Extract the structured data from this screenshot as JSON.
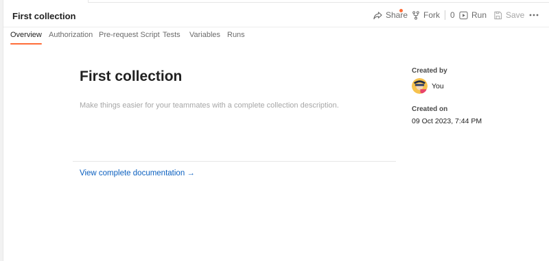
{
  "header": {
    "title": "First collection",
    "share_label": "Share",
    "fork_label": "Fork",
    "fork_count": "0",
    "run_label": "Run",
    "save_label": "Save"
  },
  "tabs": [
    {
      "label": "Overview",
      "active": true
    },
    {
      "label": "Authorization"
    },
    {
      "label": "Pre-request Script"
    },
    {
      "label": "Tests"
    },
    {
      "label": "Variables"
    },
    {
      "label": "Runs"
    }
  ],
  "overview": {
    "title": "First collection",
    "description_placeholder": "Make things easier for your teammates with a complete collection description.",
    "docs_link": "View complete documentation →"
  },
  "side": {
    "created_by_label": "Created by",
    "created_by_value": "You",
    "created_on_label": "Created on",
    "created_on_value": "09 Oct 2023, 7:44 PM"
  },
  "colors": {
    "accent": "#ff6c37",
    "link": "#0a5fbf"
  }
}
